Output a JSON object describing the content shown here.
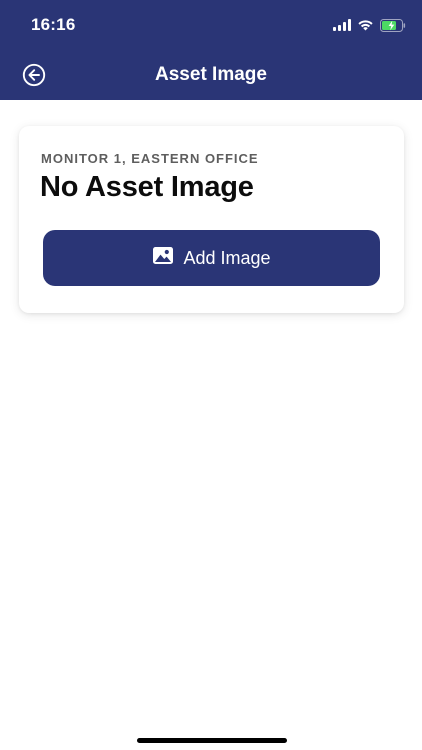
{
  "status_bar": {
    "time": "16:16",
    "icons": [
      "cellular-signal-icon",
      "wifi-icon",
      "battery-charging-icon"
    ]
  },
  "header": {
    "title": "Asset Image",
    "back_icon": "back-arrow-circle-icon",
    "background_color": "#2a3576"
  },
  "card": {
    "subtitle": "MONITOR 1, EASTERN OFFICE",
    "title": "No Asset Image",
    "button": {
      "label": "Add Image",
      "icon": "image-icon"
    }
  },
  "colors": {
    "brand": "#2a3576",
    "battery_fill": "#4cd964"
  }
}
